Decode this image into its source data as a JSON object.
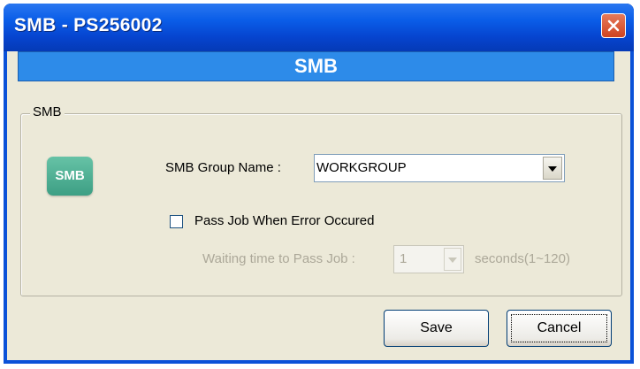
{
  "window": {
    "title": "SMB - PS256002"
  },
  "header": {
    "title": "SMB"
  },
  "group": {
    "legend": "SMB",
    "icon_text": "SMB"
  },
  "form": {
    "group_name_label": "SMB Group Name :",
    "group_name_value": "WORKGROUP",
    "pass_job_label": "Pass Job When Error Occured",
    "pass_job_checked": false,
    "waiting_label": "Waiting time to Pass Job :",
    "waiting_value": "1",
    "seconds_label": "seconds(1~120)"
  },
  "buttons": {
    "save": "Save",
    "cancel": "Cancel"
  },
  "colors": {
    "titlebar": "#0a5de8",
    "header_bar": "#2d8be9",
    "icon": "#4fb396",
    "close": "#d9532f"
  },
  "icons": {
    "close": "close-icon",
    "smb": "smb-icon",
    "dropdown": "chevron-down-icon"
  }
}
